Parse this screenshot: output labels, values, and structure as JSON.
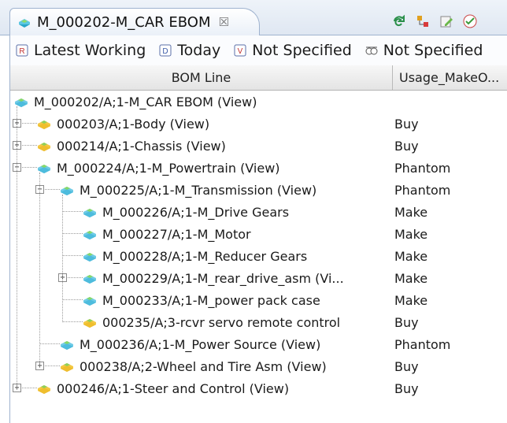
{
  "tab": {
    "title": "M_000202-M_CAR EBOM",
    "close_glyph": "☒"
  },
  "toolbar_icons": [
    "refresh-icon",
    "structure-icon",
    "edit-icon",
    "check-icon"
  ],
  "revision_rules": [
    {
      "label": "Latest Working",
      "icon": "revision-rule-icon"
    },
    {
      "label": "Today",
      "icon": "date-rule-icon"
    },
    {
      "label": "Not Specified",
      "icon": "variant-rule-icon"
    },
    {
      "label": "Not Specified",
      "icon": "effectivity-icon"
    }
  ],
  "columns": [
    "BOM Line",
    "Usage_MakeO..."
  ],
  "rows": [
    {
      "label": "M_000202/A;1-M_CAR EBOM (View)",
      "usage": "",
      "level": 0,
      "expander": "none",
      "icon": "assembly-icon"
    },
    {
      "label": "000203/A;1-Body (View)",
      "usage": "Buy",
      "level": 1,
      "expander": "+",
      "icon": "part-icon"
    },
    {
      "label": "000214/A;1-Chassis (View)",
      "usage": "Buy",
      "level": 1,
      "expander": "+",
      "icon": "part-icon"
    },
    {
      "label": "M_000224/A;1-M_Powertrain (View)",
      "usage": "Phantom",
      "level": 1,
      "expander": "-",
      "icon": "assembly-icon"
    },
    {
      "label": "M_000225/A;1-M_Transmission (View)",
      "usage": "Phantom",
      "level": 2,
      "expander": "-",
      "icon": "assembly-icon"
    },
    {
      "label": "M_000226/A;1-M_Drive Gears",
      "usage": "Make",
      "level": 3,
      "expander": "none",
      "icon": "assembly-icon"
    },
    {
      "label": "M_000227/A;1-M_Motor",
      "usage": "Make",
      "level": 3,
      "expander": "none",
      "icon": "assembly-icon"
    },
    {
      "label": "M_000228/A;1-M_Reducer Gears",
      "usage": "Make",
      "level": 3,
      "expander": "none",
      "icon": "assembly-icon"
    },
    {
      "label": "M_000229/A;1-M_rear_drive_asm (Vi...",
      "usage": "Make",
      "level": 3,
      "expander": "+",
      "icon": "assembly-icon"
    },
    {
      "label": "M_000233/A;1-M_power pack case",
      "usage": "Make",
      "level": 3,
      "expander": "none",
      "icon": "assembly-icon"
    },
    {
      "label": "000235/A;3-rcvr servo remote control",
      "usage": "Buy",
      "level": 3,
      "expander": "none",
      "icon": "part-icon"
    },
    {
      "label": "M_000236/A;1-M_Power Source (View)",
      "usage": "Phantom",
      "level": 2,
      "expander": "none",
      "icon": "assembly-icon"
    },
    {
      "label": "000238/A;2-Wheel and Tire Asm (View)",
      "usage": "Buy",
      "level": 2,
      "expander": "+",
      "icon": "part-icon"
    },
    {
      "label": "000246/A;1-Steer and Control (View)",
      "usage": "Buy",
      "level": 1,
      "expander": "+",
      "icon": "part-icon"
    }
  ]
}
